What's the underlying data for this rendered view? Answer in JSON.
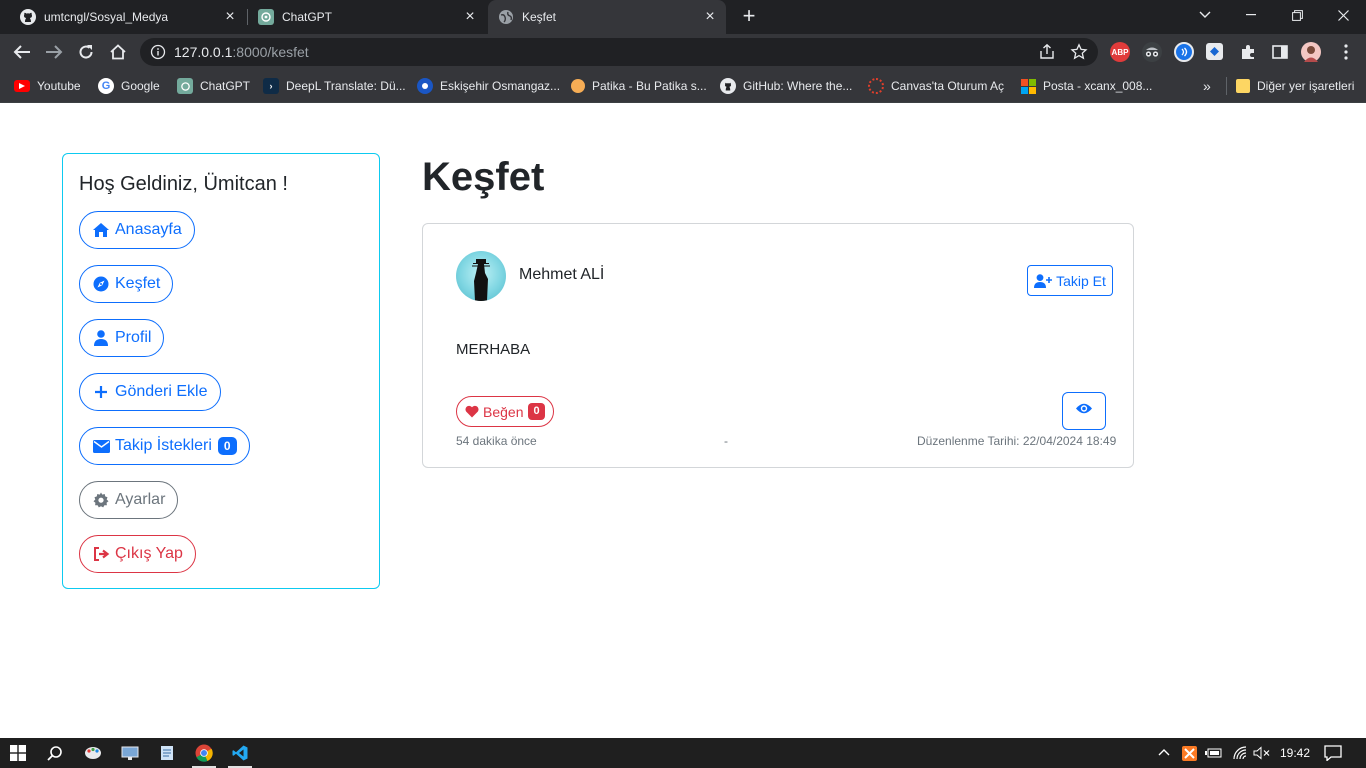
{
  "browser": {
    "tabs": [
      {
        "title": "umtcngl/Sosyal_Medya",
        "icon": "github-icon"
      },
      {
        "title": "ChatGPT",
        "icon": "chatgpt-icon"
      },
      {
        "title": "Keşfet",
        "icon": "globe-icon",
        "active": true
      }
    ],
    "url_host": "127.0.0.1",
    "url_path": ":8000/kesfet",
    "bookmarks": [
      {
        "label": "Youtube",
        "icon": "youtube-icon",
        "color": "#ff0000"
      },
      {
        "label": "Google",
        "icon": "google-icon",
        "color": "#4285f4"
      },
      {
        "label": "ChatGPT",
        "icon": "chatgpt-icon",
        "color": "#10a37f"
      },
      {
        "label": "DeepL Translate: Dü...",
        "icon": "deepl-icon",
        "color": "#0f2b46"
      },
      {
        "label": "Eskişehir Osmangaz...",
        "icon": "university-icon",
        "color": "#1a56c4"
      },
      {
        "label": "Patika - Bu Patika s...",
        "icon": "patika-icon",
        "color": "#f6ad55"
      },
      {
        "label": "GitHub: Where the...",
        "icon": "github-icon",
        "color": "#ffffff"
      },
      {
        "label": "Canvas'ta Oturum Aç",
        "icon": "canvas-icon",
        "color": "#e13f2b"
      },
      {
        "label": "Posta - xcanx_008...",
        "icon": "microsoft-icon",
        "color": "#f25022"
      }
    ],
    "other_bookmarks": "Diğer yer işaretleri"
  },
  "sidebar": {
    "welcome": "Hoş Geldiniz, Ümitcan !",
    "items": [
      {
        "label": "Anasayfa",
        "icon": "home-icon",
        "style": "primary"
      },
      {
        "label": "Keşfet",
        "icon": "compass-icon",
        "style": "primary"
      },
      {
        "label": "Profil",
        "icon": "user-icon",
        "style": "primary"
      },
      {
        "label": "Gönderi Ekle",
        "icon": "plus-icon",
        "style": "primary"
      },
      {
        "label": "Takip İstekleri",
        "icon": "envelope-icon",
        "style": "primary",
        "badge": "0"
      },
      {
        "label": "Ayarlar",
        "icon": "gear-icon",
        "style": "secondary"
      },
      {
        "label": "Çıkış Yap",
        "icon": "sign-out-icon",
        "style": "danger"
      }
    ]
  },
  "main": {
    "title": "Keşfet",
    "post": {
      "author": "Mehmet ALİ",
      "follow_label": "Takip Et",
      "text": "MERHABA",
      "like_label": "Beğen",
      "like_count": "0",
      "time_ago": "54 dakika önce",
      "separator": "-",
      "edited": "Düzenlenme Tarihi: 22/04/2024 18:49"
    }
  },
  "taskbar": {
    "clock": "19:42"
  },
  "colors": {
    "primary": "#0d6efd",
    "danger": "#dc3545",
    "secondary": "#6c757d",
    "sidebar_border": "#0dcaf0"
  }
}
